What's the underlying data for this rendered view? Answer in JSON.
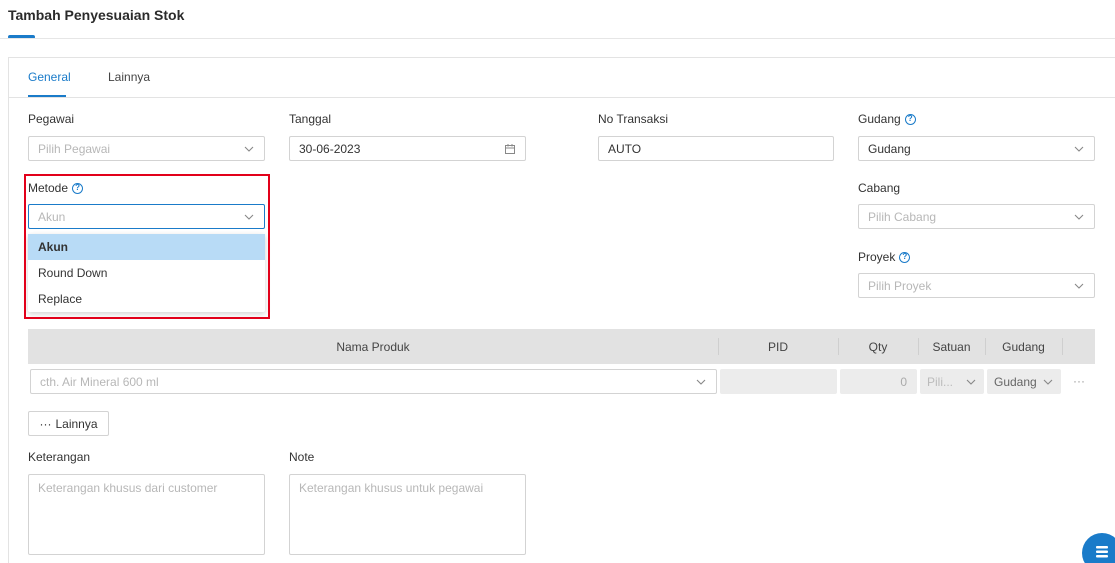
{
  "header": {
    "title": "Tambah Penyesuaian Stok"
  },
  "tabs": [
    {
      "label": "General",
      "active": true
    },
    {
      "label": "Lainnya",
      "active": false
    }
  ],
  "form": {
    "pegawai": {
      "label": "Pegawai",
      "placeholder": "Pilih Pegawai"
    },
    "tanggal": {
      "label": "Tanggal",
      "value": "30-06-2023"
    },
    "no_transaksi": {
      "label": "No Transaksi",
      "value": "AUTO"
    },
    "gudang": {
      "label": "Gudang",
      "value": "Gudang"
    },
    "metode": {
      "label": "Metode",
      "placeholder": "Akun",
      "options": [
        "Akun",
        "Round Down",
        "Replace"
      ],
      "selected": "Akun"
    },
    "cabang": {
      "label": "Cabang",
      "placeholder": "Pilih Cabang"
    },
    "proyek": {
      "label": "Proyek",
      "placeholder": "Pilih Proyek"
    }
  },
  "table": {
    "columns": [
      "Nama Produk",
      "PID",
      "Qty",
      "Satuan",
      "Gudang"
    ],
    "row": {
      "product_placeholder": "cth. Air Mineral 600 ml",
      "qty": "0",
      "satuan": "Pili...",
      "gudang": "Gudang",
      "more": "···"
    }
  },
  "more_button": {
    "icon": "···",
    "label": "Lainnya"
  },
  "notes": {
    "keterangan": {
      "label": "Keterangan",
      "placeholder": "Keterangan khusus dari customer"
    },
    "note": {
      "label": "Note",
      "placeholder": "Keterangan khusus untuk pegawai"
    }
  },
  "colors": {
    "accent": "#1a7bc9",
    "highlight": "#e2001a",
    "selected_bg": "#b8dbf6"
  },
  "icons": {
    "help": "?",
    "chevron": "chevron-down-icon",
    "calendar": "calendar-icon",
    "fab": "list-icon"
  }
}
